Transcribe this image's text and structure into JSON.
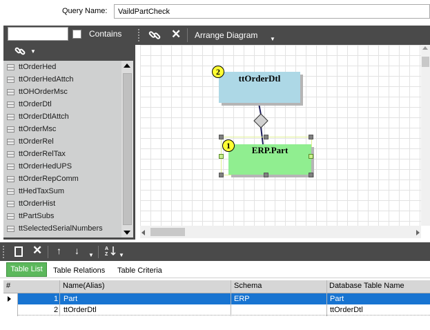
{
  "query": {
    "label": "Query Name:",
    "value": "VaildPartCheck"
  },
  "left_panel": {
    "search_value": "",
    "contains_label": "Contains",
    "tables": [
      "ttOrderHed",
      "ttOrderHedAttch",
      "ttOHOrderMsc",
      "ttOrderDtl",
      "ttOrderDtlAttch",
      "ttOrderMsc",
      "ttOrderRel",
      "ttOrderRelTax",
      "ttOrderHedUPS",
      "ttOrderRepComm",
      "ttHedTaxSum",
      "ttOrderHist",
      "ttPartSubs",
      "ttSelectedSerialNumbers"
    ]
  },
  "diagram_toolbar": {
    "arrange_label": "Arrange Diagram"
  },
  "diagram": {
    "nodes": [
      {
        "badge": "2",
        "title": "ttOrderDtl",
        "color": "#add8e6"
      },
      {
        "badge": "1",
        "title": "ERP.Part",
        "color": "#90ee90"
      }
    ]
  },
  "tabs": {
    "table_list": "Table List",
    "table_relations": "Table Relations",
    "table_criteria": "Table Criteria"
  },
  "grid": {
    "headers": {
      "num": "#",
      "name": "Name(Alias)",
      "schema": "Schema",
      "db_table": "Database Table Name"
    },
    "rows": [
      {
        "num": "1",
        "name": "Part",
        "schema": "ERP",
        "db_table": "Part"
      },
      {
        "num": "2",
        "name": "ttOrderDtl",
        "schema": "",
        "db_table": "ttOrderDtl"
      }
    ]
  },
  "colors": {
    "toolbar": "#4a4a4a",
    "selected_row": "#1874d1",
    "active_tab": "#5cb85c"
  }
}
